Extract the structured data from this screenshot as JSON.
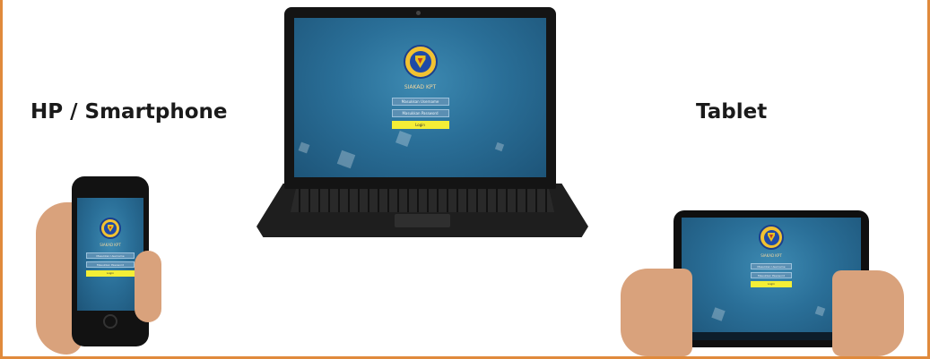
{
  "labels": {
    "smartphone": "HP / Smartphone",
    "tablet": "Tablet"
  },
  "login_screen": {
    "app_title": "SIAKAD KPT",
    "username_placeholder": "Masukkan Username",
    "password_placeholder": "Masukkan Password",
    "login_button": "Login"
  },
  "colors": {
    "frame_border": "#e08a3c",
    "screen_bg": "#2a6f98",
    "login_button": "#f4ee36"
  }
}
